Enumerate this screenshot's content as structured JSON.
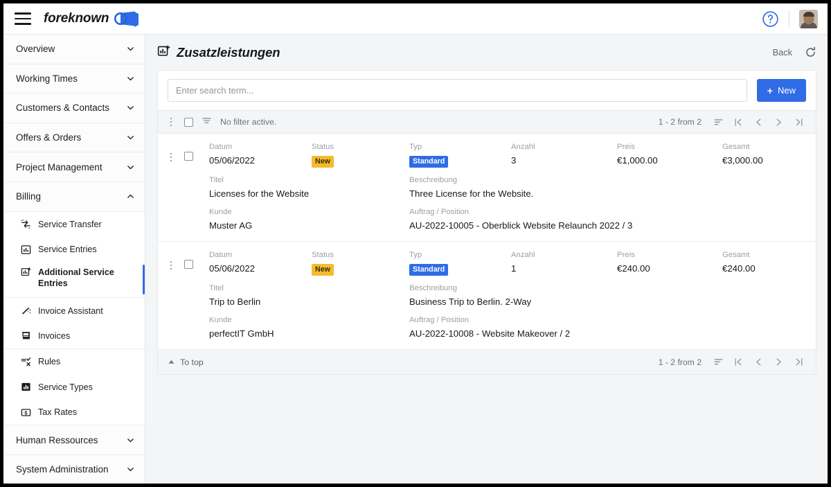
{
  "app": {
    "logo_text": "foreknown",
    "menu_icon": "hamburger-icon",
    "help_icon": "help-circle-icon",
    "avatar_icon": "user-avatar",
    "accent_color": "#2f6ce5",
    "badge_new_color": "#f5bb2e",
    "frame_color": "#000000"
  },
  "sidebar": {
    "groups": [
      {
        "label": "Overview",
        "expanded": false,
        "chevron": "chevron-down-icon"
      },
      {
        "label": "Working Times",
        "expanded": false,
        "chevron": "chevron-down-icon"
      },
      {
        "label": "Customers & Contacts",
        "expanded": false,
        "chevron": "chevron-down-icon"
      },
      {
        "label": "Offers & Orders",
        "expanded": false,
        "chevron": "chevron-down-icon"
      },
      {
        "label": "Project Management",
        "expanded": false,
        "chevron": "chevron-down-icon"
      },
      {
        "label": "Billing",
        "expanded": true,
        "chevron": "chevron-up-icon"
      }
    ],
    "billing_items": [
      {
        "label": "Service Transfer",
        "icon": "service-transfer-icon",
        "active": false
      },
      {
        "label": "Service Entries",
        "icon": "chart-box-icon",
        "active": false
      },
      {
        "label": "Additional Service Entries",
        "icon": "chart-box-plus-icon",
        "active": true
      },
      {
        "label": "Invoice Assistant",
        "icon": "magic-wand-icon",
        "active": false
      },
      {
        "label": "Invoices",
        "icon": "receipt-icon",
        "active": false
      },
      {
        "label": "Rules",
        "icon": "rules-icon",
        "active": false
      },
      {
        "label": "Service Types",
        "icon": "bar-chart-icon",
        "active": false
      },
      {
        "label": "Tax Rates",
        "icon": "currency-box-icon",
        "active": false
      }
    ],
    "groups_bottom": [
      {
        "label": "Human Ressources",
        "expanded": false,
        "chevron": "chevron-down-icon"
      },
      {
        "label": "System Administration",
        "expanded": false,
        "chevron": "chevron-down-icon"
      }
    ]
  },
  "page": {
    "title": "Zusatzleistungen",
    "title_icon": "chart-box-plus-icon",
    "back_label": "Back",
    "refresh_icon": "refresh-icon"
  },
  "search": {
    "value": "",
    "placeholder": "Enter search term...",
    "new_label": "New",
    "new_icon": "plus-icon"
  },
  "toolbar": {
    "kebab_icon": "kebab-menu-icon",
    "select_all_icon": "checkbox-unchecked-icon",
    "filter_icon": "filter-icon",
    "filter_text": "No filter active.",
    "page_count": "1 - 2 from 2",
    "sort_icon": "sort-icon",
    "first_icon": "first-page-icon",
    "prev_icon": "previous-page-icon",
    "next_icon": "next-page-icon",
    "last_icon": "last-page-icon"
  },
  "columns": {
    "datum": "Datum",
    "status": "Status",
    "typ": "Typ",
    "anzahl": "Anzahl",
    "preis": "Preis",
    "gesamt": "Gesamt",
    "titel": "Titel",
    "beschreibung": "Beschreibung",
    "kunde": "Kunde",
    "auftrag": "Auftrag / Position"
  },
  "rows": [
    {
      "datum": "05/06/2022",
      "status": "New",
      "typ": "Standard",
      "anzahl": "3",
      "preis": "€1,000.00",
      "gesamt": "€3,000.00",
      "titel": "Licenses for the Website",
      "beschreibung": "Three License for the Website.",
      "kunde": "Muster AG",
      "auftrag": "AU-2022-10005 - Oberblick Website Relaunch 2022 / 3"
    },
    {
      "datum": "05/06/2022",
      "status": "New",
      "typ": "Standard",
      "anzahl": "1",
      "preis": "€240.00",
      "gesamt": "€240.00",
      "titel": "Trip to Berlin",
      "beschreibung": "Business Trip to Berlin. 2-Way",
      "kunde": "perfectIT GmbH",
      "auftrag": "AU-2022-10008 - Website Makeover / 2"
    }
  ],
  "footer": {
    "to_top_label": "To top",
    "to_top_icon": "caret-up-icon",
    "page_count": "1 - 2 from 2",
    "sort_icon": "sort-icon",
    "first_icon": "first-page-icon",
    "prev_icon": "previous-page-icon",
    "next_icon": "next-page-icon",
    "last_icon": "last-page-icon"
  }
}
